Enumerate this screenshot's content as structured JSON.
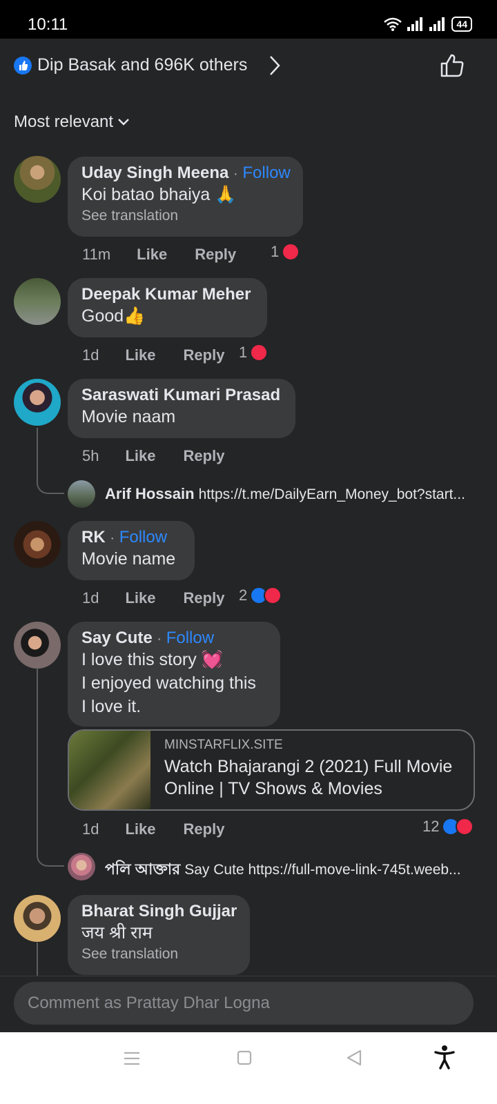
{
  "status": {
    "time": "10:11",
    "battery": "44"
  },
  "reactions": {
    "summary": "Dip Basak and 696K others"
  },
  "sort": {
    "label": "Most relevant"
  },
  "follow_label": "Follow",
  "comments": [
    {
      "name": "Uday Singh Meena",
      "text": "Koi batao bhaiya 🙏",
      "translation": "See translation",
      "time": "11m",
      "like": "Like",
      "reply": "Reply",
      "reactions": "1"
    },
    {
      "name": "Deepak Kumar Meher",
      "text": "Good👍",
      "time": "1d",
      "like": "Like",
      "reply": "Reply",
      "reactions": "1"
    },
    {
      "name": "Saraswati Kumari Prasad",
      "text": "Movie naam",
      "time": "5h",
      "like": "Like",
      "reply": "Reply",
      "reply_preview": {
        "name": "Arif Hossain",
        "text": "https://t.me/DailyEarn_Money_bot?start..."
      }
    },
    {
      "name": "RK",
      "text": "Movie name",
      "time": "1d",
      "like": "Like",
      "reply": "Reply",
      "reactions": "2"
    },
    {
      "name": "Say Cute",
      "lines": [
        "I love this story 💓",
        "I enjoyed watching this",
        "I love it."
      ],
      "link": {
        "domain": "MINSTARFLIX.SITE",
        "title": "Watch Bhajarangi 2 (2021) Full Movie Online | TV Shows & Movies"
      },
      "time": "1d",
      "like": "Like",
      "reply": "Reply",
      "reactions": "12",
      "reply_preview": {
        "name": "পলি আক্তার",
        "text": "Say Cute https://full-move-link-745t.weeb..."
      }
    },
    {
      "name": "Bharat Singh Gujjar",
      "text": "जय श्री राम",
      "translation": "See translation"
    }
  ],
  "composer": {
    "placeholder": "Comment as Prattay Dhar Logna"
  }
}
